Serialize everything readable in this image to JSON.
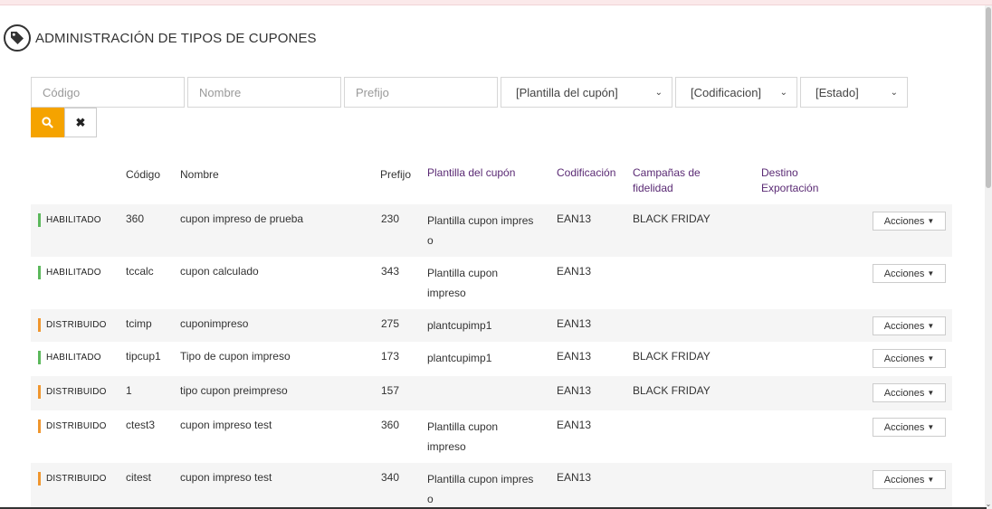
{
  "page": {
    "title": "ADMINISTRACIÓN DE TIPOS DE CUPONES"
  },
  "filters": {
    "codigo_placeholder": "Código",
    "nombre_placeholder": "Nombre",
    "prefijo_placeholder": "Prefijo",
    "plantilla_selected": "[Plantilla del cupón]",
    "codificacion_selected": "[Codificacion]",
    "estado_selected": "[Estado]"
  },
  "buttons": {
    "clear_glyph": "✖"
  },
  "columns": {
    "codigo": "Código",
    "nombre": "Nombre",
    "prefijo": "Prefijo",
    "plantilla": "Plantilla del cupón",
    "codificacion": "Codificación",
    "campanas_1": "Campañas de",
    "campanas_2": "fidelidad",
    "destino_1": "Destino",
    "destino_2": "Exportación"
  },
  "colors": {
    "habilitado": "#5cb85c",
    "distribuido": "#f0962e",
    "search_button": "#f5a300",
    "header_purple": "#5a2a74"
  },
  "rows": [
    {
      "estado": "HABILITADO",
      "codigo": "360",
      "nombre": "cupon impreso de prueba",
      "prefijo": "230",
      "plantilla_1": "Plantilla cupon impres",
      "plantilla_2": "o",
      "codificacion": "EAN13",
      "campana": "BLACK FRIDAY",
      "acciones": "Acciones"
    },
    {
      "estado": "HABILITADO",
      "codigo": "tccalc",
      "nombre": "cupon calculado",
      "prefijo": "343",
      "plantilla_1": "Plantilla cupon",
      "plantilla_2": "impreso",
      "codificacion": "EAN13",
      "campana": "",
      "acciones": "Acciones"
    },
    {
      "estado": "DISTRIBUIDO",
      "codigo": "tcimp",
      "nombre": "cuponimpreso",
      "prefijo": "275",
      "plantilla_1": "plantcupimp1",
      "plantilla_2": "",
      "codificacion": "EAN13",
      "campana": "",
      "acciones": "Acciones"
    },
    {
      "estado": "HABILITADO",
      "codigo": "tipcup1",
      "nombre": "Tipo de cupon impreso",
      "prefijo": "173",
      "plantilla_1": "plantcupimp1",
      "plantilla_2": "",
      "codificacion": "EAN13",
      "campana": "BLACK FRIDAY",
      "acciones": "Acciones"
    },
    {
      "estado": "DISTRIBUIDO",
      "codigo": "1",
      "nombre": "tipo cupon preimpreso",
      "prefijo": "157",
      "plantilla_1": "",
      "plantilla_2": "",
      "codificacion": "EAN13",
      "campana": "BLACK FRIDAY",
      "acciones": "Acciones"
    },
    {
      "estado": "DISTRIBUIDO",
      "codigo": "ctest3",
      "nombre": "cupon impreso test",
      "prefijo": "360",
      "plantilla_1": "Plantilla cupon",
      "plantilla_2": "impreso",
      "codificacion": "EAN13",
      "campana": "",
      "acciones": "Acciones"
    },
    {
      "estado": "DISTRIBUIDO",
      "codigo": "citest",
      "nombre": "cupon impreso test",
      "prefijo": "340",
      "plantilla_1": "Plantilla cupon impres",
      "plantilla_2": "o",
      "codificacion": "EAN13",
      "campana": "",
      "acciones": "Acciones"
    }
  ]
}
